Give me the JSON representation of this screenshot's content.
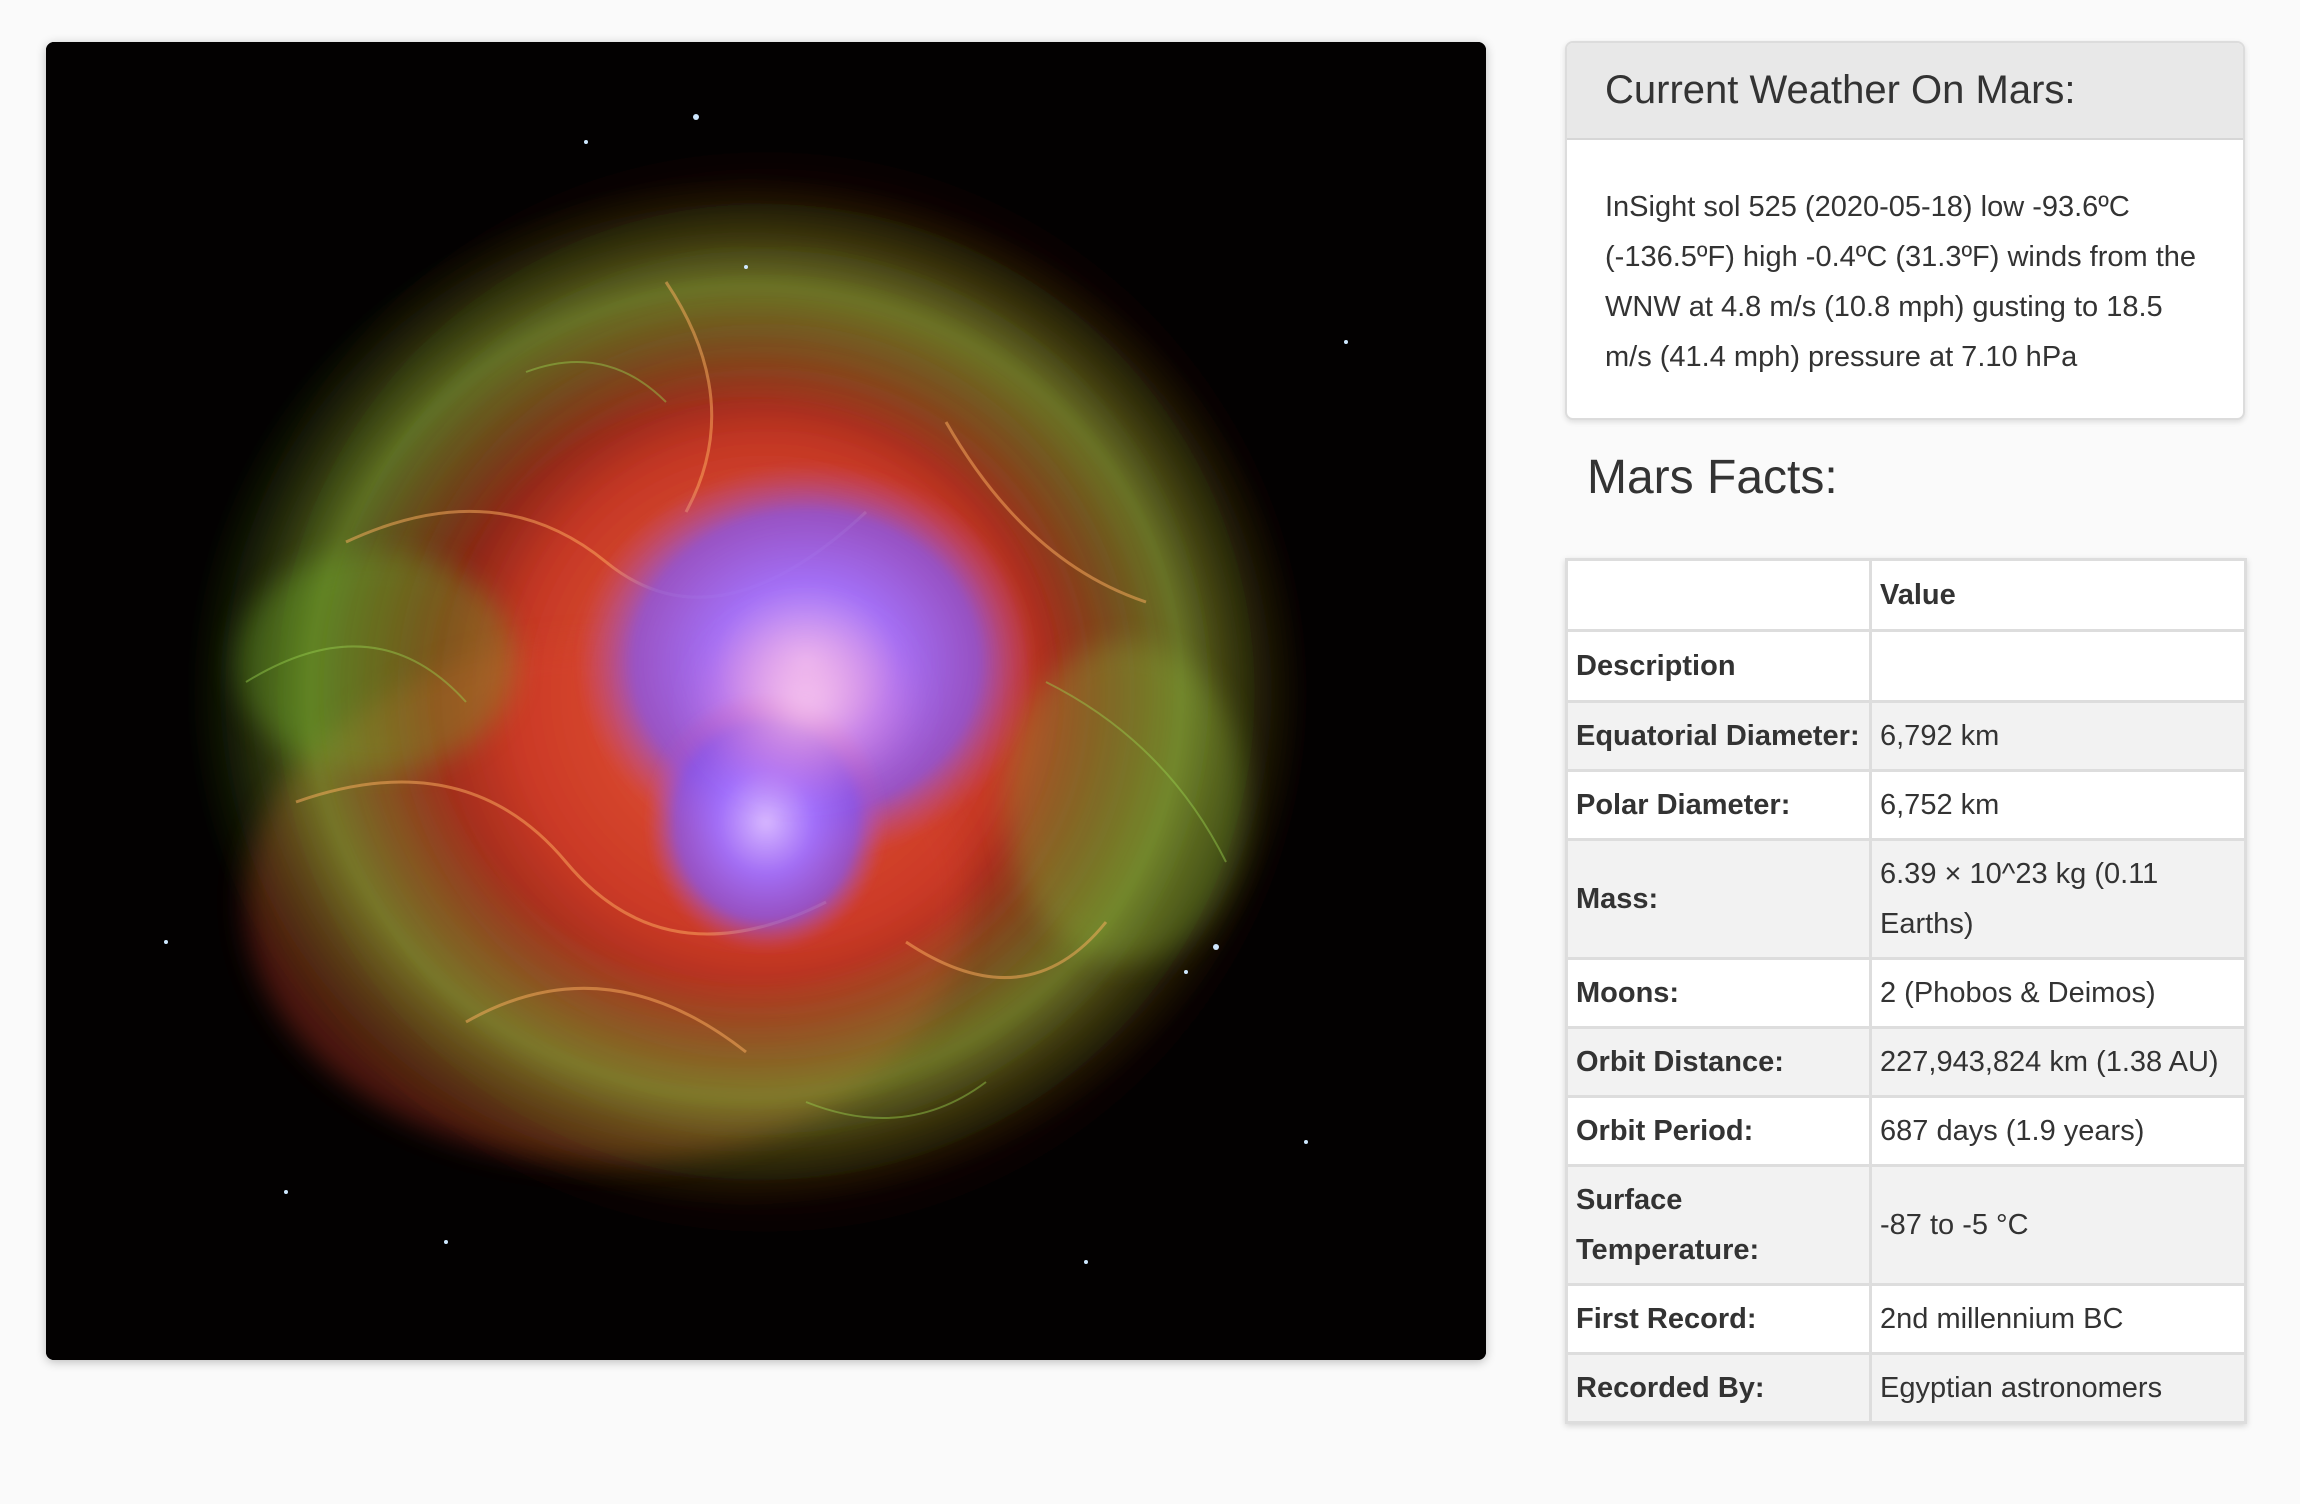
{
  "weather": {
    "heading": "Current Weather On Mars:",
    "report": "InSight sol 525 (2020-05-18) low -93.6ºC (-136.5ºF) high -0.4ºC (31.3ºF) winds from the WNW at 4.8 m/s (10.8 mph) gusting to 18.5 m/s (41.4 mph) pressure at 7.10 hPa"
  },
  "facts": {
    "title": "Mars Facts:",
    "columns": [
      "",
      "Value"
    ],
    "rows": [
      {
        "label": "Description",
        "value": ""
      },
      {
        "label": "Equatorial Diameter:",
        "value": "6,792 km"
      },
      {
        "label": "Polar Diameter:",
        "value": "6,752 km"
      },
      {
        "label": "Mass:",
        "value": "6.39 × 10^23 kg (0.11 Earths)"
      },
      {
        "label": "Moons:",
        "value": "2 (Phobos & Deimos)"
      },
      {
        "label": "Orbit Distance:",
        "value": "227,943,824 km (1.38 AU)"
      },
      {
        "label": "Orbit Period:",
        "value": "687 days (1.9 years)"
      },
      {
        "label": "Surface Temperature:",
        "value": "-87 to -5 °C"
      },
      {
        "label": "First Record:",
        "value": "2nd millennium BC"
      },
      {
        "label": "Recorded By:",
        "value": "Egyptian astronomers"
      }
    ]
  },
  "colors": {
    "page_background": "#fafafa",
    "panel_heading_background": "#e8e8e8",
    "table_stripe": "#f2f2f2",
    "text": "#333333"
  }
}
